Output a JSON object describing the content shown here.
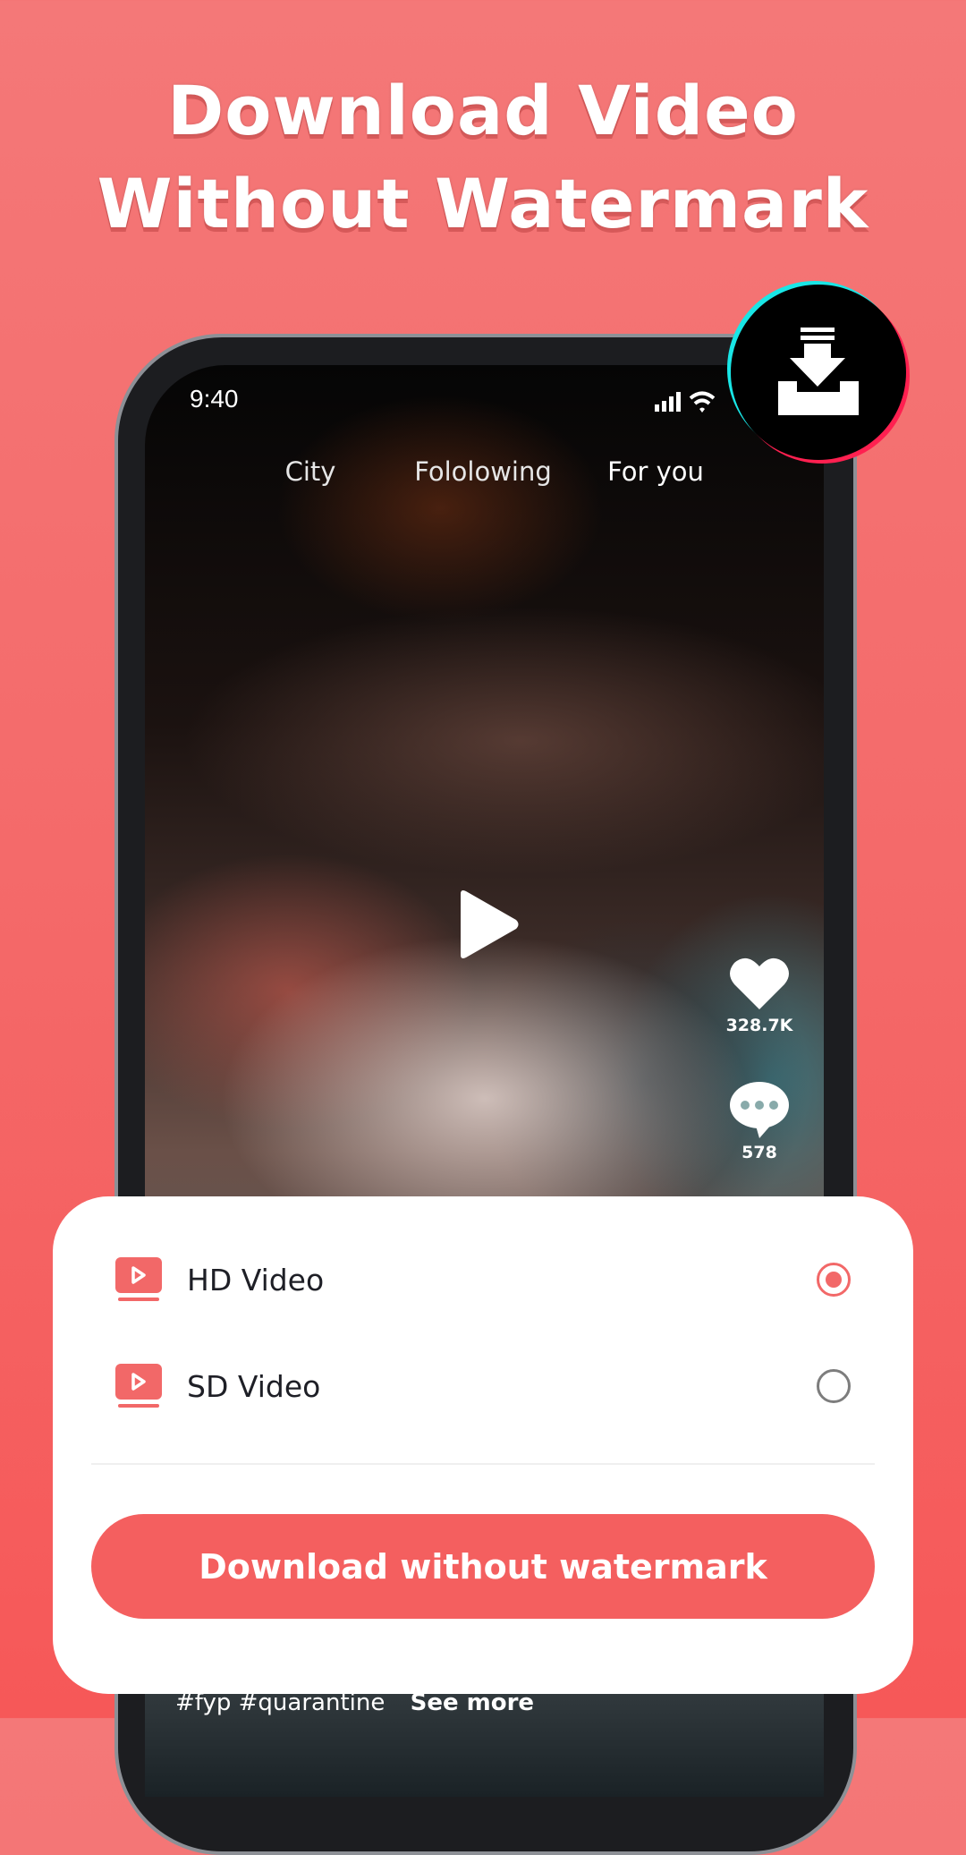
{
  "headline": {
    "line1": "Download Video",
    "line2": "Without Watermark"
  },
  "phone": {
    "status_time": "9:40",
    "tabs": [
      {
        "label": "City"
      },
      {
        "label": "Fololowing"
      },
      {
        "label": "For you",
        "active": true
      }
    ],
    "likes": "328.7K",
    "comments": "578",
    "caption_tags": "#fyp #quarantine",
    "see_more": "See more"
  },
  "badge_icon": "download-tray-icon",
  "options": [
    {
      "label": "HD Video",
      "icon": "video-play-icon",
      "selected": true
    },
    {
      "label": "SD Video",
      "icon": "video-play-icon",
      "selected": false
    }
  ],
  "download_button": "Download without watermark",
  "colors": {
    "accent": "#f45f5f",
    "background_top": "#f47878",
    "background_bottom": "#f65858",
    "badge_cyan": "#19e6e6",
    "badge_pink": "#ff2050"
  }
}
